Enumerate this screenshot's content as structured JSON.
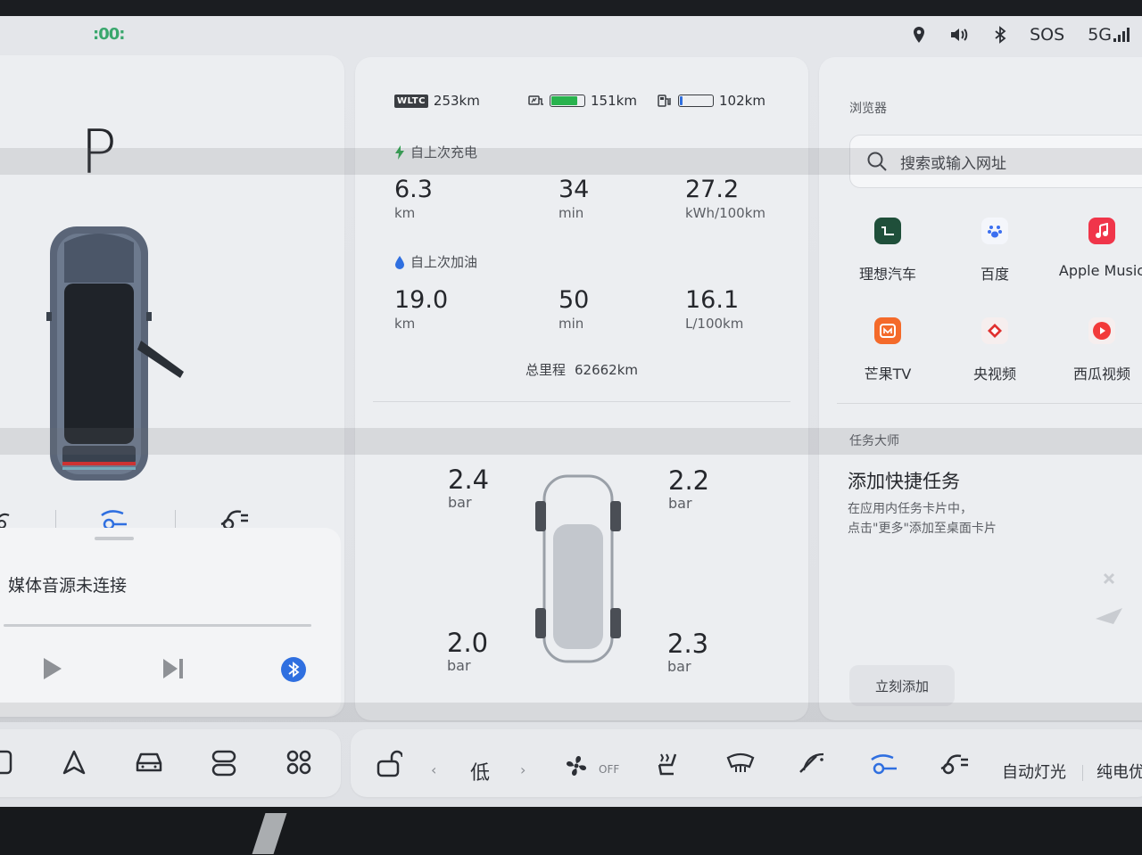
{
  "status_bar": {
    "left_icon": "energy-mode-icon",
    "left_text": ":00:",
    "location_icon": "location-pin-icon",
    "volume_icon": "volume-icon",
    "bluetooth_icon": "bluetooth-icon",
    "sos": "SOS",
    "network": "5G"
  },
  "vehicle": {
    "gear": "P",
    "modes": [
      "comfort-mode-icon",
      "ride-mode-icon",
      "driving-mode-icon"
    ]
  },
  "media": {
    "status": "媒体音源未连接",
    "play_icon": "play-icon",
    "next_icon": "next-track-icon",
    "bluetooth_icon": "bluetooth-icon"
  },
  "range": {
    "wltc_badge": "WLTC",
    "wltc_value": "253km",
    "electric_value": "151km",
    "electric_level": 0.75,
    "fuel_value": "102km",
    "fuel_level": 0.08
  },
  "since_charge": {
    "title": "自上次充电",
    "distance_value": "6.3",
    "distance_unit": "km",
    "time_value": "34",
    "time_unit": "min",
    "consumption_value": "27.2",
    "consumption_unit": "kWh/100km"
  },
  "since_refuel": {
    "title": "自上次加油",
    "distance_value": "19.0",
    "distance_unit": "km",
    "time_value": "50",
    "time_unit": "min",
    "consumption_value": "16.1",
    "consumption_unit": "L/100km"
  },
  "odometer": {
    "label": "总里程",
    "value": "62662km"
  },
  "tyres": {
    "front_left": {
      "value": "2.4",
      "unit": "bar"
    },
    "front_right": {
      "value": "2.2",
      "unit": "bar"
    },
    "rear_left": {
      "value": "2.0",
      "unit": "bar"
    },
    "rear_right": {
      "value": "2.3",
      "unit": "bar"
    }
  },
  "browser": {
    "title": "浏览器",
    "search_placeholder": "搜索或输入网址",
    "apps": [
      {
        "label": "理想汽车",
        "icon": "li-auto-icon",
        "color": "#1f4f3a"
      },
      {
        "label": "百度",
        "icon": "baidu-icon",
        "color": "#3b6ff0"
      },
      {
        "label": "Apple Music",
        "icon": "apple-music-icon",
        "color": "#f0354a"
      },
      {
        "label": "芒果TV",
        "icon": "mango-tv-icon",
        "color": "#f46a2a"
      },
      {
        "label": "央视频",
        "icon": "cctv-video-icon",
        "color": "#e0302f"
      },
      {
        "label": "西瓜视频",
        "icon": "xigua-video-icon",
        "color": "#f23a3a"
      }
    ]
  },
  "task_master": {
    "title": "任务大师",
    "heading": "添加快捷任务",
    "desc_line1": "在应用内任务卡片中，",
    "desc_line2": "点击\"更多\"添加至桌面卡片",
    "button": "立刻添加"
  },
  "dock_left": {
    "icons": [
      "screen-icon",
      "navigation-icon",
      "car-icon",
      "switch-icon",
      "apps-grid-icon"
    ]
  },
  "dock_right": {
    "lock_icon": "unlock-icon",
    "fan_level": "低",
    "fan_state": "OFF",
    "auto_light": "自动灯光",
    "ev_priority": "纯电优"
  }
}
